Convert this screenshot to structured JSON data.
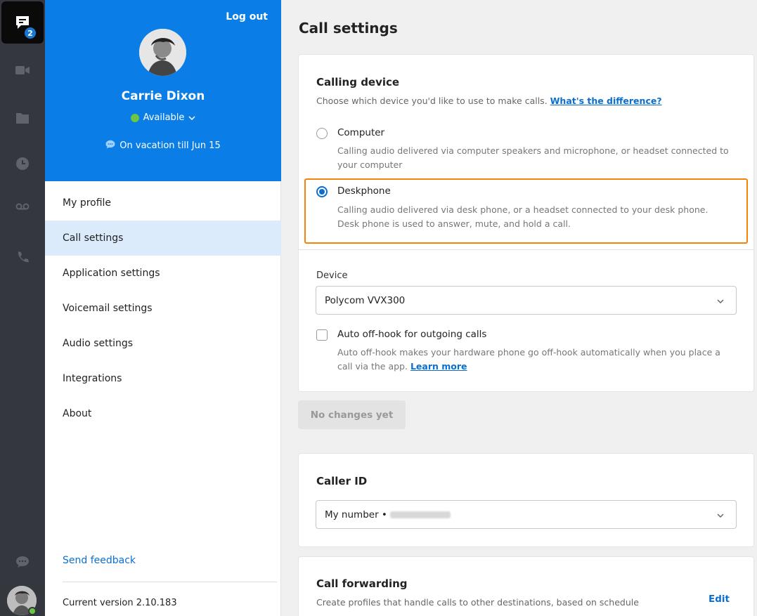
{
  "rail": {
    "badge_count": "2",
    "items": [
      "chat-icon",
      "video-icon",
      "folder-icon",
      "clock-icon",
      "voicemail-icon",
      "phone-icon"
    ],
    "bottom": [
      "feedback-icon",
      "user-avatar"
    ]
  },
  "profile": {
    "logout_label": "Log out",
    "name": "Carrie Dixon",
    "availability": "Available",
    "status_message": "On vacation till Jun 15"
  },
  "nav": {
    "items": [
      {
        "label": "My profile",
        "active": false
      },
      {
        "label": "Call settings",
        "active": true
      },
      {
        "label": "Application settings",
        "active": false
      },
      {
        "label": "Voicemail settings",
        "active": false
      },
      {
        "label": "Audio settings",
        "active": false
      },
      {
        "label": "Integrations",
        "active": false
      },
      {
        "label": "About",
        "active": false
      }
    ],
    "feedback_label": "Send feedback",
    "version": "Current version 2.10.183"
  },
  "main": {
    "title": "Call settings",
    "calling_device": {
      "heading": "Calling device",
      "description": "Choose which device you'd like to use to make calls.",
      "link": "What's the difference?",
      "options": [
        {
          "title": "Computer",
          "desc_line1": "Calling audio delivered via computer speakers and microphone, or headset connected to",
          "desc_line2": "your computer",
          "checked": false
        },
        {
          "title": "Deskphone",
          "desc_line1": "Calling audio delivered via desk phone, or a headset connected to your desk phone.",
          "desc_line2": "Desk phone is used to answer, mute, and hold a call.",
          "checked": true
        }
      ],
      "device_label": "Device",
      "device_value": "Polycom VVX300",
      "offhook_label": "Auto off-hook for outgoing calls",
      "offhook_checked": false,
      "offhook_desc_line1": "Auto off-hook makes your hardware phone go off-hook automatically when you place a",
      "offhook_desc_line2": "call via the app.",
      "offhook_link": "Learn more"
    },
    "save_button": "No changes yet",
    "caller_id": {
      "heading": "Caller ID",
      "value": "My number •"
    },
    "call_forwarding": {
      "heading": "Call forwarding",
      "description": "Create profiles that handle calls to other destinations, based on schedule",
      "edit_label": "Edit"
    }
  },
  "colors": {
    "rail_bg": "#34373d",
    "profile_bg": "#0a7ee6",
    "accent": "#0a6fd0",
    "highlight": "#f5820d",
    "available": "#6cc644"
  }
}
